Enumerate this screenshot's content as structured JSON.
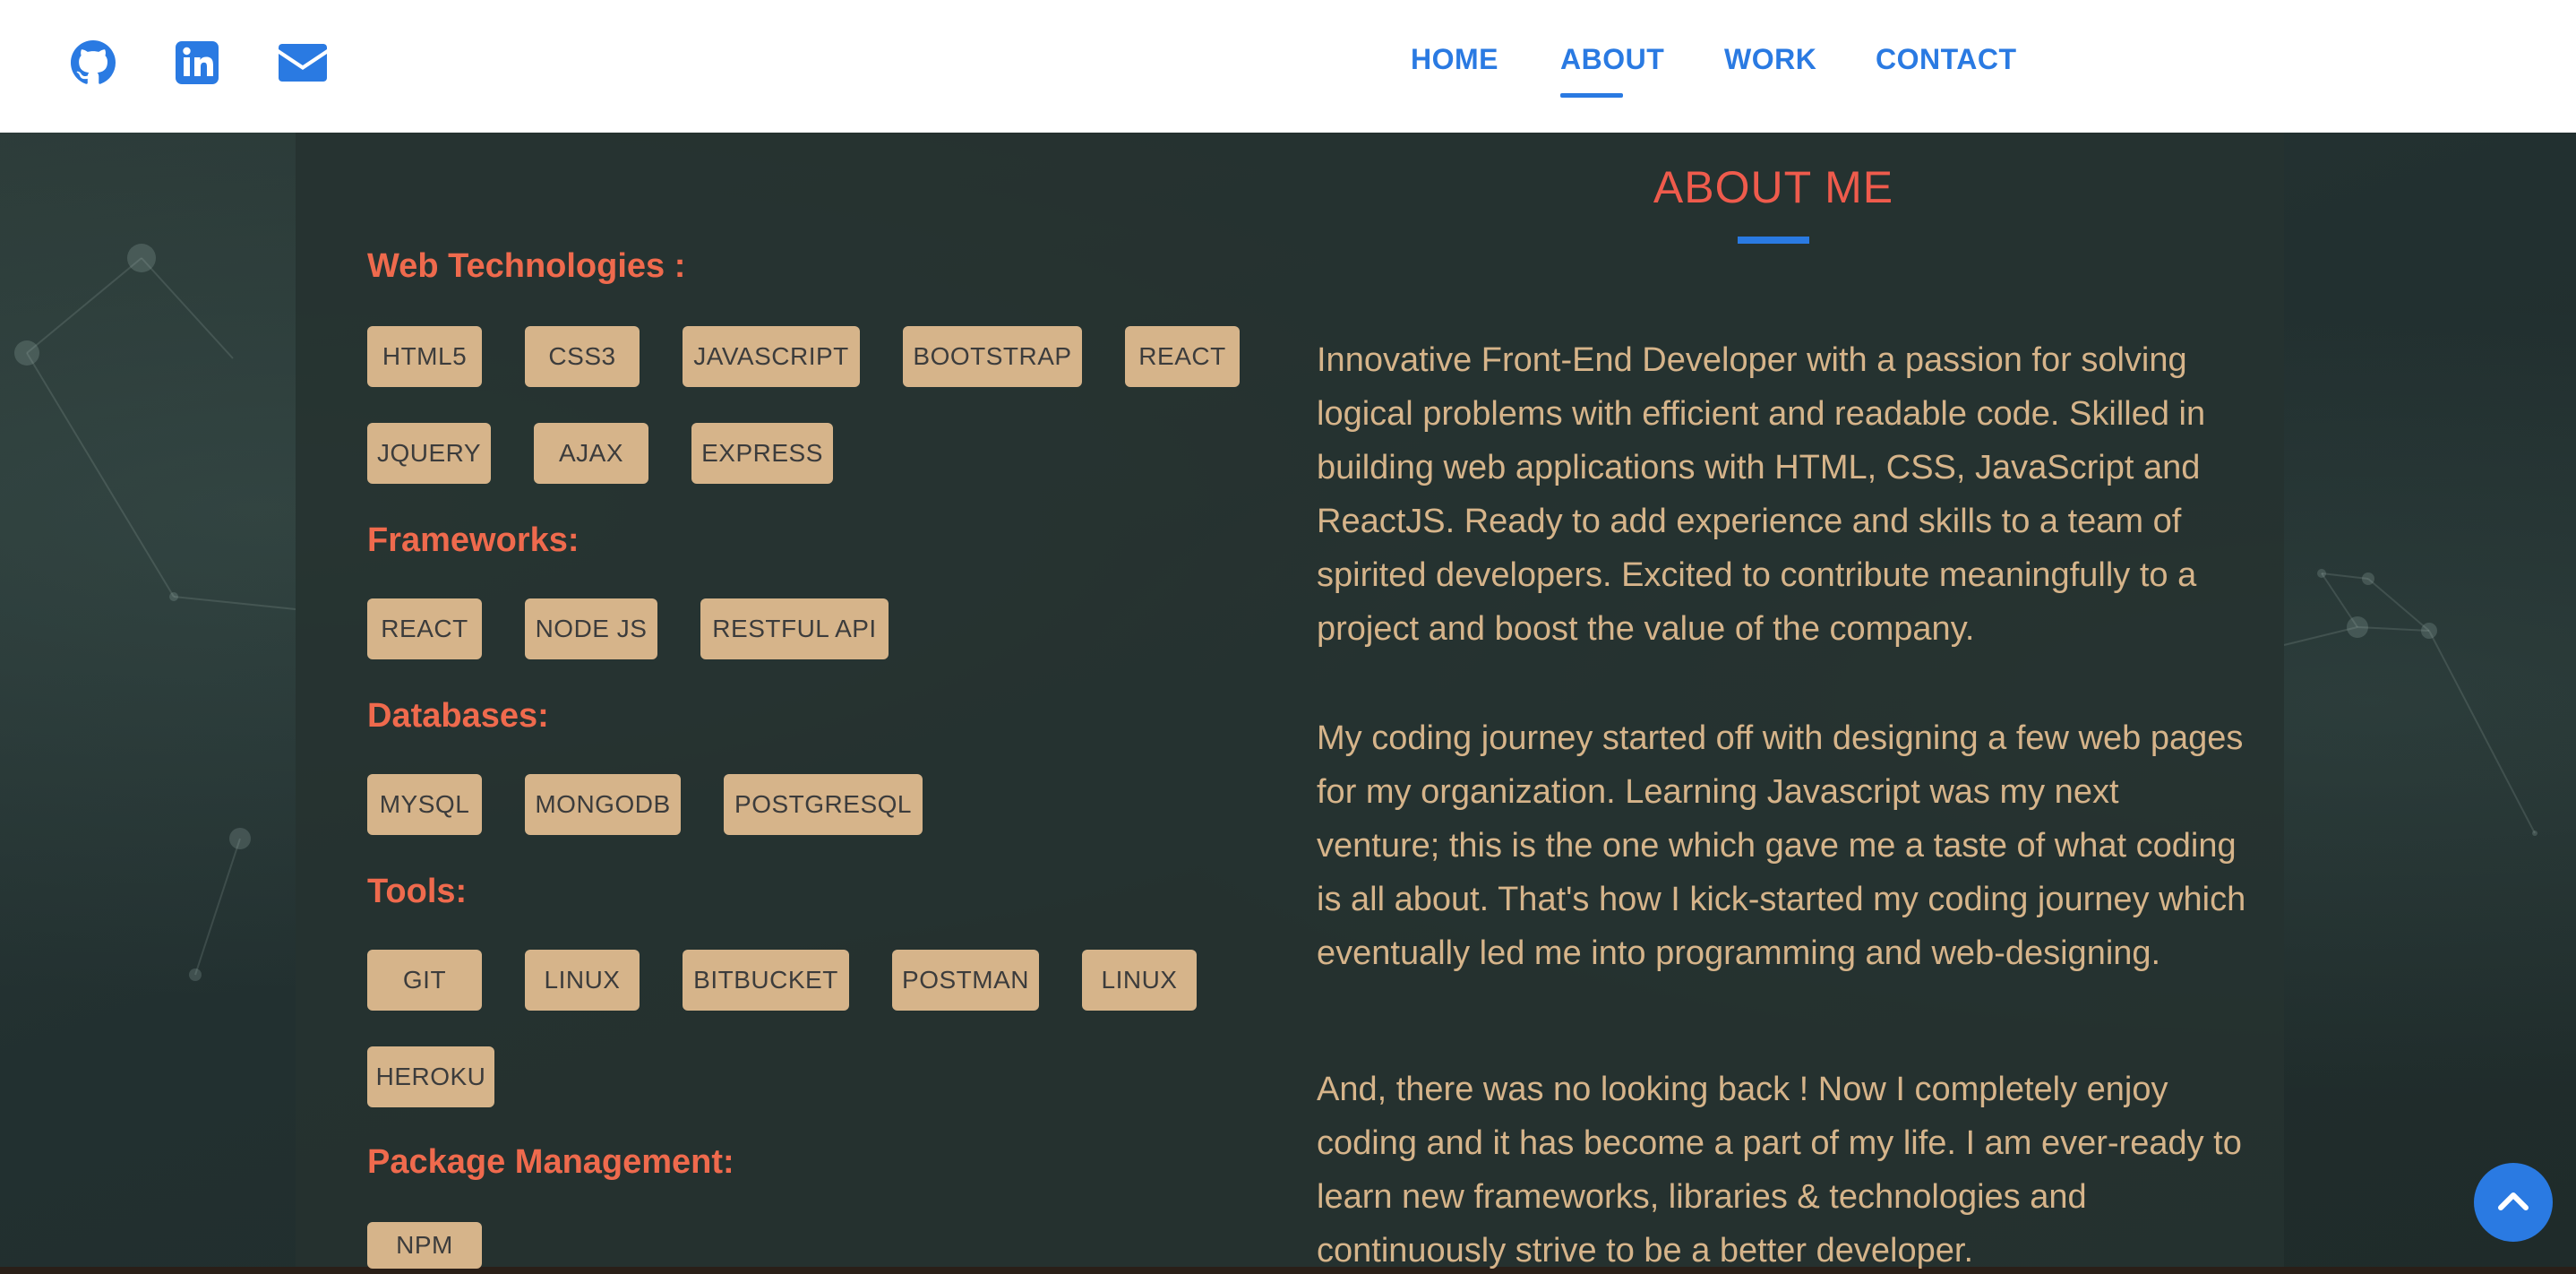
{
  "header": {
    "social": [
      {
        "icon": "github-icon"
      },
      {
        "icon": "linkedin-icon"
      },
      {
        "icon": "envelope-icon"
      }
    ],
    "nav": [
      "HOME",
      "ABOUT",
      "WORK",
      "CONTACT"
    ],
    "active_nav": "ABOUT"
  },
  "about": {
    "title": "ABOUT ME",
    "paragraphs": [
      "Innovative Front-End Developer with a passion for solving logical problems with efficient and readable code. Skilled in building web applications with HTML, CSS, JavaScript and ReactJS. Ready to add experience and skills to a team of spirited developers. Excited to contribute meaningfully to a project and boost the value of the company.",
      "My coding journey started off with designing a few web pages for my organization. Learning Javascript was my next venture; this is the one which gave me a taste of what coding is all about. That's how I kick-started my coding journey which eventually led me into programming and web-designing.",
      "And, there was no looking back ! Now I completely enjoy coding and it has become a part of my life. I am ever-ready to learn new frameworks, libraries & technologies and continuously strive to be a better developer."
    ]
  },
  "skills": {
    "web": {
      "heading": "Web Technologies :",
      "tags": [
        "HTML5",
        "CSS3",
        "JAVASCRIPT",
        "BOOTSTRAP",
        "REACT",
        "JQUERY",
        "AJAX",
        "EXPRESS"
      ]
    },
    "frameworks": {
      "heading": "Frameworks:",
      "tags": [
        "REACT",
        "NODE JS",
        "RESTFUL API"
      ]
    },
    "databases": {
      "heading": "Databases:",
      "tags": [
        "MYSQL",
        "MONGODB",
        "POSTGRESQL"
      ]
    },
    "tools": {
      "heading": "Tools:",
      "tags": [
        "GIT",
        "LINUX",
        "BITBUCKET",
        "POSTMAN",
        "LINUX",
        "HEROKU"
      ]
    },
    "package": {
      "heading": "Package Management:",
      "tags": [
        "NPM"
      ]
    }
  },
  "colors": {
    "accent": "#2a7ae2",
    "heading": "#ef6a4d",
    "tag_bg": "#d6b48a",
    "text": "#d6b48a"
  },
  "scroll_top_icon": "chevron-up-icon"
}
